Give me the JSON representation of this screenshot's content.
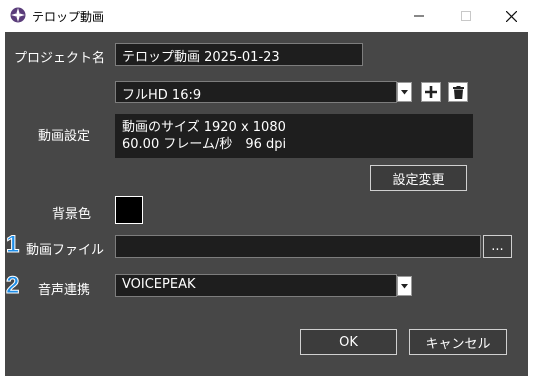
{
  "window": {
    "title": "テロップ動画",
    "controls": {
      "minimize": "minimize",
      "maximize": "maximize",
      "close": "close"
    }
  },
  "form": {
    "project_label": "プロジェクト名",
    "project_value": "テロップ動画 2025-01-23",
    "preset_value": "フルHD 16:9",
    "video_settings_label": "動画設定",
    "video_info_line1": "動画のサイズ 1920 x 1080",
    "video_info_line2": "60.00 フレーム/秒　96 dpi",
    "change_settings_button": "設定変更",
    "bg_color_label": "背景色",
    "bg_color_value": "#000000",
    "video_file_label": "動画ファイル",
    "video_file_value": "",
    "browse_button": "...",
    "voice_label": "音声連携",
    "voice_value": "VOICEPEAK",
    "badge1": "1",
    "badge2": "2"
  },
  "footer": {
    "ok_button": "OK",
    "cancel_button": "キャンセル"
  },
  "colors": {
    "background": "#474747",
    "field": "#1e1e1e",
    "badge": "#1e8ee8"
  }
}
